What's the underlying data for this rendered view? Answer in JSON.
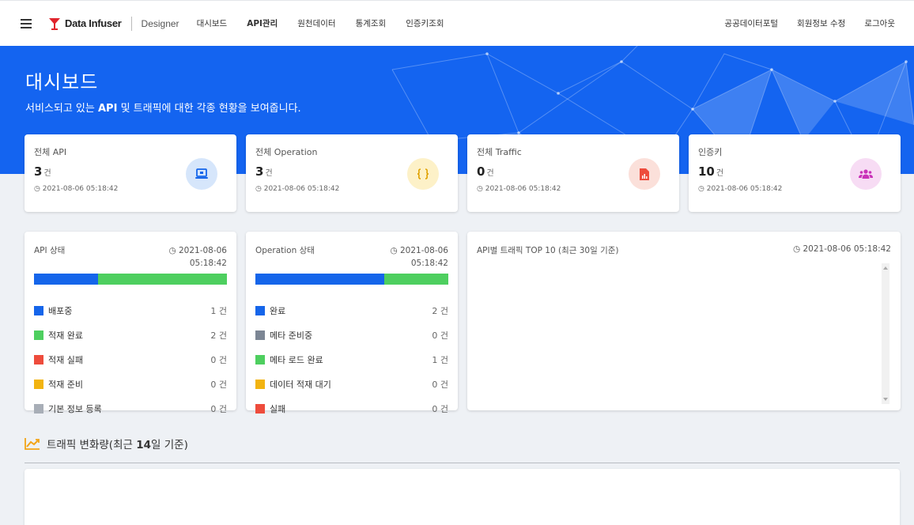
{
  "header": {
    "logo_text": "Data Infuser",
    "logo_sub": "Designer",
    "nav": [
      "대시보드",
      "API관리",
      "원천데이터",
      "통계조회",
      "인증키조회"
    ],
    "nav_right": [
      "공공데이터포털",
      "회원정보 수정",
      "로그아웃"
    ]
  },
  "hero": {
    "title": "대시보드",
    "desc_pre": "서비스되고 있는 ",
    "desc_api": "API",
    "desc_post": " 및 트래픽에 대한 각종 현황을 보여줍니다."
  },
  "stats": [
    {
      "label": "전체 API",
      "value": "3",
      "unit": "건",
      "time": "2021-08-06 05:18:42",
      "icon": "monitor-icon",
      "color": "#d6e6fb"
    },
    {
      "label": "전체 Operation",
      "value": "3",
      "unit": "건",
      "time": "2021-08-06 05:18:42",
      "icon": "code-braces-icon",
      "color": "#fdf1c8"
    },
    {
      "label": "전체 Traffic",
      "value": "0",
      "unit": "건",
      "time": "2021-08-06 05:18:42",
      "icon": "chart-file-icon",
      "color": "#fbe0da"
    },
    {
      "label": "인증키",
      "value": "10",
      "unit": "건",
      "time": "2021-08-06 05:18:42",
      "icon": "users-icon",
      "color": "#f7dcf4"
    }
  ],
  "api_status": {
    "title": "API 상태",
    "date": "2021-08-06",
    "time": "05:18:42",
    "bar": [
      {
        "color": "#1565ea",
        "value": 1
      },
      {
        "color": "#4ecf5f",
        "value": 2
      }
    ],
    "items": [
      {
        "label": "배포중",
        "count": "1 건",
        "color": "#1565ea"
      },
      {
        "label": "적재 완료",
        "count": "2 건",
        "color": "#4ecf5f"
      },
      {
        "label": "적재 실패",
        "count": "0 건",
        "color": "#ee4c3c"
      },
      {
        "label": "적재 준비",
        "count": "0 건",
        "color": "#f2b411"
      },
      {
        "label": "기본 정보 등록",
        "count": "0 건",
        "color": "#a8aeb7"
      }
    ]
  },
  "op_status": {
    "title": "Operation 상태",
    "date": "2021-08-06",
    "time": "05:18:42",
    "bar": [
      {
        "color": "#1565ea",
        "value": 2
      },
      {
        "color": "#4ecf5f",
        "value": 1
      }
    ],
    "items": [
      {
        "label": "완료",
        "count": "2 건",
        "color": "#1565ea"
      },
      {
        "label": "메타 준비중",
        "count": "0 건",
        "color": "#7c8694"
      },
      {
        "label": "메타 로드 완료",
        "count": "1 건",
        "color": "#4ecf5f"
      },
      {
        "label": "데이터 적재 대기",
        "count": "0 건",
        "color": "#f2b411"
      },
      {
        "label": "실패",
        "count": "0 건",
        "color": "#ee4c3c"
      }
    ]
  },
  "top10": {
    "title": "API별 트래픽 TOP 10 (최근 30일 기준)",
    "time": "2021-08-06 05:18:42"
  },
  "trend": {
    "title_pre": "트래픽 변화량(최근 ",
    "title_num": "14",
    "title_post": "일 기준)"
  }
}
